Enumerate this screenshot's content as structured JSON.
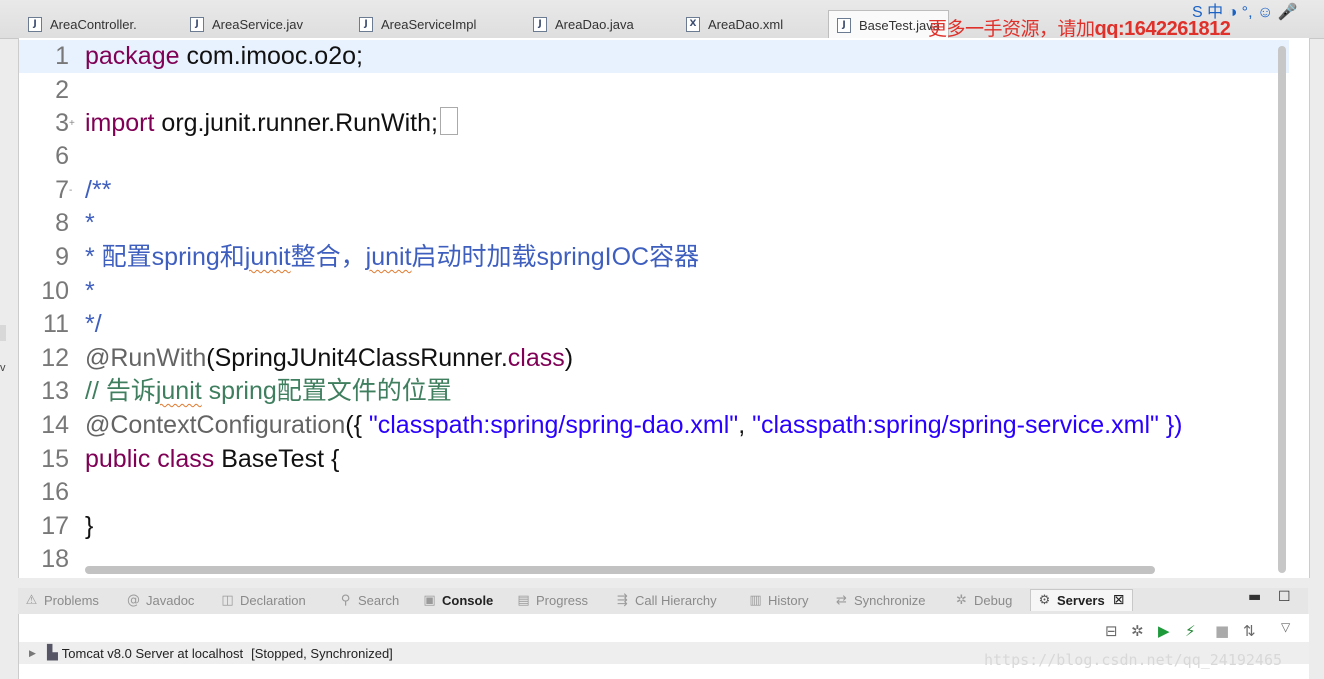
{
  "tabs": [
    {
      "label": "AreaController.",
      "icon": "J",
      "active": false
    },
    {
      "label": "AreaService.jav",
      "icon": "J",
      "active": false
    },
    {
      "label": "AreaServiceImpl",
      "icon": "J",
      "active": false
    },
    {
      "label": "AreaDao.java",
      "icon": "J",
      "active": false
    },
    {
      "label": "AreaDao.xml",
      "icon": "X",
      "active": false
    },
    {
      "label": "BaseTest.java",
      "icon": "J",
      "active": true
    }
  ],
  "watermark": {
    "prefix": "更多一手资源，请加",
    "qq": "qq:1642261812"
  },
  "system_icons": "S 中 ◑ °, ☺ 🎤",
  "editor": {
    "lines": [
      {
        "num": "1",
        "fold": "",
        "current": true,
        "tokens": [
          {
            "t": "package",
            "c": "kw"
          },
          {
            "t": " com.imooc.o2o;",
            "c": ""
          }
        ]
      },
      {
        "num": "2",
        "fold": "",
        "tokens": []
      },
      {
        "num": "3",
        "fold": "+",
        "cursor_box": true,
        "tokens": [
          {
            "t": "import",
            "c": "kw"
          },
          {
            "t": " org.junit.runner.RunWith;",
            "c": ""
          }
        ]
      },
      {
        "num": "6",
        "fold": "",
        "tokens": []
      },
      {
        "num": "7",
        "fold": "-",
        "tokens": [
          {
            "t": "/**",
            "c": "cm"
          }
        ]
      },
      {
        "num": "8",
        "fold": "",
        "tokens": [
          {
            "t": " *",
            "c": "cm"
          }
        ]
      },
      {
        "num": "9",
        "fold": "",
        "tokens": [
          {
            "t": " * 配置spring和",
            "c": "cm"
          },
          {
            "t": "junit",
            "c": "cm sq"
          },
          {
            "t": "整合，",
            "c": "cm"
          },
          {
            "t": "junit",
            "c": "cm sq"
          },
          {
            "t": "启动时加载springIOC容器",
            "c": "cm"
          }
        ]
      },
      {
        "num": "10",
        "fold": "",
        "tokens": [
          {
            "t": " *",
            "c": "cm"
          }
        ]
      },
      {
        "num": "11",
        "fold": "",
        "tokens": [
          {
            "t": " */",
            "c": "cm"
          }
        ]
      },
      {
        "num": "12",
        "fold": "",
        "tokens": [
          {
            "t": "@RunWith",
            "c": "an"
          },
          {
            "t": "(SpringJUnit4ClassRunner.",
            "c": ""
          },
          {
            "t": "class",
            "c": "kw"
          },
          {
            "t": ")",
            "c": ""
          }
        ]
      },
      {
        "num": "13",
        "fold": "",
        "tokens": [
          {
            "t": "// 告诉",
            "c": "gc"
          },
          {
            "t": "junit",
            "c": "gc sq"
          },
          {
            "t": " spring配置文件的位置",
            "c": "gc"
          }
        ]
      },
      {
        "num": "14",
        "fold": "",
        "tokens": [
          {
            "t": "@ContextConfiguration",
            "c": "an"
          },
          {
            "t": "({ ",
            "c": ""
          },
          {
            "t": "\"classpath:spring/spring-dao.xml\"",
            "c": "st"
          },
          {
            "t": ", ",
            "c": ""
          },
          {
            "t": "\"classpath:spring/spring-service.xml\" })",
            "c": "st"
          }
        ]
      },
      {
        "num": "15",
        "fold": "",
        "tokens": [
          {
            "t": "public",
            "c": "kw"
          },
          {
            "t": " ",
            "c": ""
          },
          {
            "t": "class",
            "c": "kw"
          },
          {
            "t": " BaseTest {",
            "c": ""
          }
        ]
      },
      {
        "num": "16",
        "fold": "",
        "tokens": []
      },
      {
        "num": "17",
        "fold": "",
        "tokens": [
          {
            "t": "}",
            "c": ""
          }
        ]
      },
      {
        "num": "18",
        "fold": "",
        "tokens": []
      }
    ]
  },
  "views": {
    "tabs": [
      {
        "label": "Problems",
        "icon": "⚠",
        "bold": false
      },
      {
        "label": "Javadoc",
        "icon": "@",
        "bold": false
      },
      {
        "label": "Declaration",
        "icon": "◫",
        "bold": false
      },
      {
        "label": "Search",
        "icon": "⚲",
        "bold": false
      },
      {
        "label": "Console",
        "icon": "▣",
        "bold": true
      },
      {
        "label": "Progress",
        "icon": "▤",
        "bold": false
      },
      {
        "label": "Call Hierarchy",
        "icon": "⇶",
        "bold": false
      },
      {
        "label": "History",
        "icon": "▥",
        "bold": false
      },
      {
        "label": "Synchronize",
        "icon": "⇄",
        "bold": false
      },
      {
        "label": "Debug",
        "icon": "✲",
        "bold": false
      },
      {
        "label": "Servers",
        "icon": "⚙",
        "bold": true,
        "active": true
      }
    ],
    "close_glyph": "⊠",
    "minimize_glyph": "▬",
    "maximize_glyph": "☐"
  },
  "servers_panel": {
    "server_name": "Tomcat v8.0 Server at localhost",
    "status": "[Stopped, Synchronized]"
  },
  "url_watermark": "https://blog.csdn.net/qq_24192465",
  "left_edge_mark": "v"
}
